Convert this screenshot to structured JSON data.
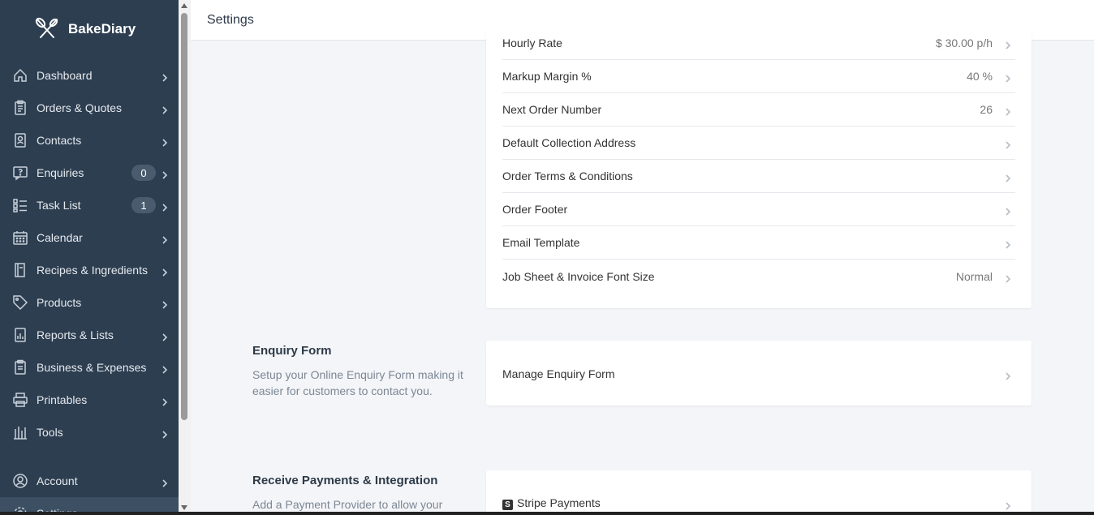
{
  "brand": {
    "name": "BakeDiary"
  },
  "sidebar": {
    "items": [
      {
        "label": "Dashboard",
        "icon": "home-icon",
        "badge": null
      },
      {
        "label": "Orders & Quotes",
        "icon": "clipboard-icon",
        "badge": null
      },
      {
        "label": "Contacts",
        "icon": "contact-book-icon",
        "badge": null
      },
      {
        "label": "Enquiries",
        "icon": "question-chat-icon",
        "badge": "0"
      },
      {
        "label": "Task List",
        "icon": "checklist-icon",
        "badge": "1"
      },
      {
        "label": "Calendar",
        "icon": "calendar-icon",
        "badge": null
      },
      {
        "label": "Recipes & Ingredients",
        "icon": "recipe-book-icon",
        "badge": null
      },
      {
        "label": "Products",
        "icon": "tag-icon",
        "badge": null
      },
      {
        "label": "Reports & Lists",
        "icon": "report-icon",
        "badge": null
      },
      {
        "label": "Business & Expenses",
        "icon": "receipt-icon",
        "badge": null
      },
      {
        "label": "Printables",
        "icon": "printer-icon",
        "badge": null
      },
      {
        "label": "Tools",
        "icon": "tools-icon",
        "badge": null
      },
      {
        "label": "Account",
        "icon": "account-icon",
        "badge": null
      },
      {
        "label": "Settings",
        "icon": "gear-icon",
        "badge": null
      }
    ]
  },
  "header": {
    "title": "Settings"
  },
  "order_settings": {
    "rows": [
      {
        "label": "Hourly Rate",
        "value": "$ 30.00 p/h"
      },
      {
        "label": "Markup Margin %",
        "value": "40 %"
      },
      {
        "label": "Next Order Number",
        "value": "26"
      },
      {
        "label": "Default Collection Address",
        "value": ""
      },
      {
        "label": "Order Terms & Conditions",
        "value": ""
      },
      {
        "label": "Order Footer",
        "value": ""
      },
      {
        "label": "Email Template",
        "value": ""
      },
      {
        "label": "Job Sheet & Invoice Font Size",
        "value": "Normal"
      }
    ]
  },
  "enquiry_form": {
    "title": "Enquiry Form",
    "description": "Setup your Online Enquiry Form making it easier for customers to contact you.",
    "row_label": "Manage Enquiry Form"
  },
  "payments": {
    "title": "Receive Payments & Integration",
    "description": "Add a Payment Provider to allow your",
    "row_label": "Stripe Payments",
    "stripe_glyph": "S"
  },
  "colors": {
    "sidebar_bg": "#2d3e50",
    "active_item": "#3c4f63",
    "page_bg": "#f4f5f8"
  }
}
